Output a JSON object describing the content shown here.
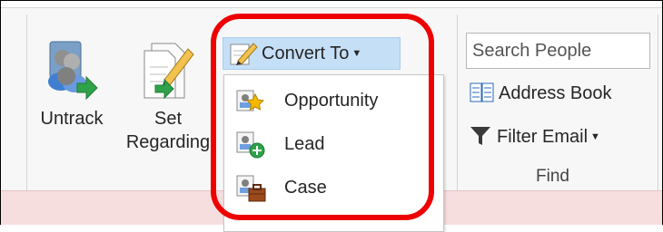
{
  "buttons": {
    "untrack": "Untrack",
    "set_regarding_line1": "Set",
    "set_regarding_line2": "Regarding",
    "convert_to": "Convert To"
  },
  "convert_menu": {
    "items": [
      {
        "label": "Opportunity",
        "icon": "opportunity-icon"
      },
      {
        "label": "Lead",
        "icon": "lead-icon"
      },
      {
        "label": "Case",
        "icon": "case-icon"
      }
    ]
  },
  "find": {
    "search_placeholder": "Search People",
    "address_book": "Address Book",
    "filter_email": "Filter Email",
    "group_label": "Find"
  },
  "colors": {
    "highlight": "#ee0000",
    "selected_button": "#c5dff7",
    "bottom_bar": "#f7dede"
  }
}
